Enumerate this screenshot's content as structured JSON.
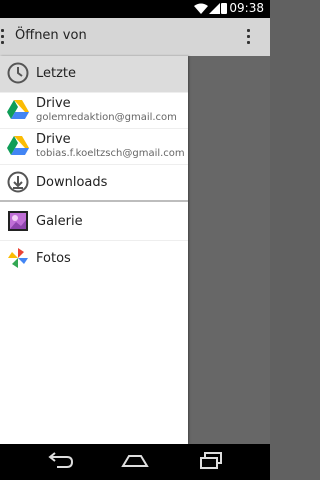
{
  "statusbar": {
    "time": "09:38"
  },
  "appbar": {
    "title": "Öffnen von"
  },
  "drawer": {
    "items": [
      {
        "label": "Letzte"
      },
      {
        "label": "Drive",
        "account": "golemredaktion@gmail.com"
      },
      {
        "label": "Drive",
        "account": "tobias.f.koeltzsch@gmail.com"
      },
      {
        "label": "Downloads"
      },
      {
        "label": "Galerie"
      },
      {
        "label": "Fotos"
      }
    ]
  },
  "icons": {
    "recent": "clock-icon",
    "drive": "google-drive-icon",
    "downloads": "download-icon",
    "gallery": "gallery-icon",
    "photos": "photos-pinwheel-icon"
  },
  "colors": {
    "appbar": "#d6d6d6",
    "selected_row": "#dcdcdc",
    "scrim": "#676767"
  }
}
